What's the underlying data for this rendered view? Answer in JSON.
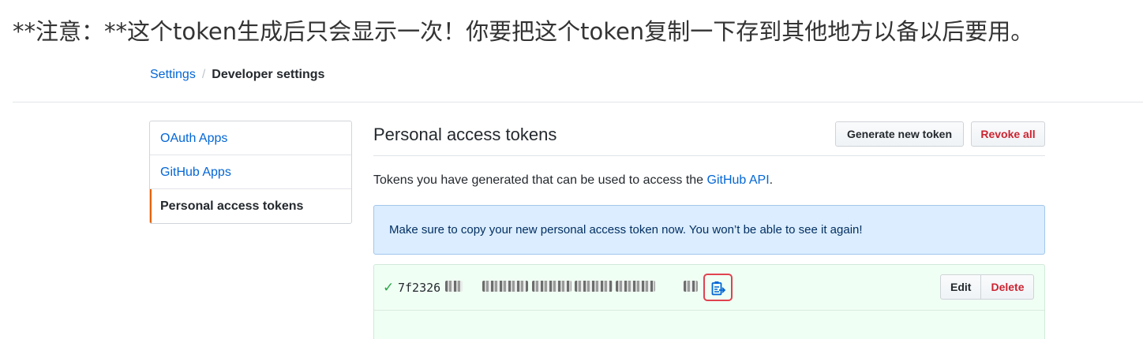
{
  "annotation": {
    "text": "**注意：**这个token生成后只会显示一次！你要把这个token复制一下存到其他地方以备以后要用。"
  },
  "breadcrumb": {
    "parent": "Settings",
    "separator": "/",
    "current": "Developer settings"
  },
  "sidebar": {
    "items": [
      {
        "label": "OAuth Apps",
        "selected": false
      },
      {
        "label": "GitHub Apps",
        "selected": false
      },
      {
        "label": "Personal access tokens",
        "selected": true
      }
    ]
  },
  "main": {
    "title": "Personal access tokens",
    "generate_button": "Generate new token",
    "revoke_button": "Revoke all",
    "description_prefix": "Tokens you have generated that can be used to access the ",
    "description_link": "GitHub API",
    "description_suffix": ".",
    "flash_message": "Make sure to copy your new personal access token now. You won’t be able to see it again!"
  },
  "token": {
    "visible_prefix": "7f2326",
    "status_icon": "check-icon",
    "copy_icon": "clipboard-copy-icon",
    "edit_button": "Edit",
    "delete_button": "Delete"
  },
  "colors": {
    "link": "#0366d6",
    "danger": "#cb2431",
    "success": "#28a745",
    "flash_bg": "#dbedff",
    "token_bg": "#f0fff4",
    "highlight_frame": "#e0424f",
    "selected_marker": "#e36209"
  }
}
